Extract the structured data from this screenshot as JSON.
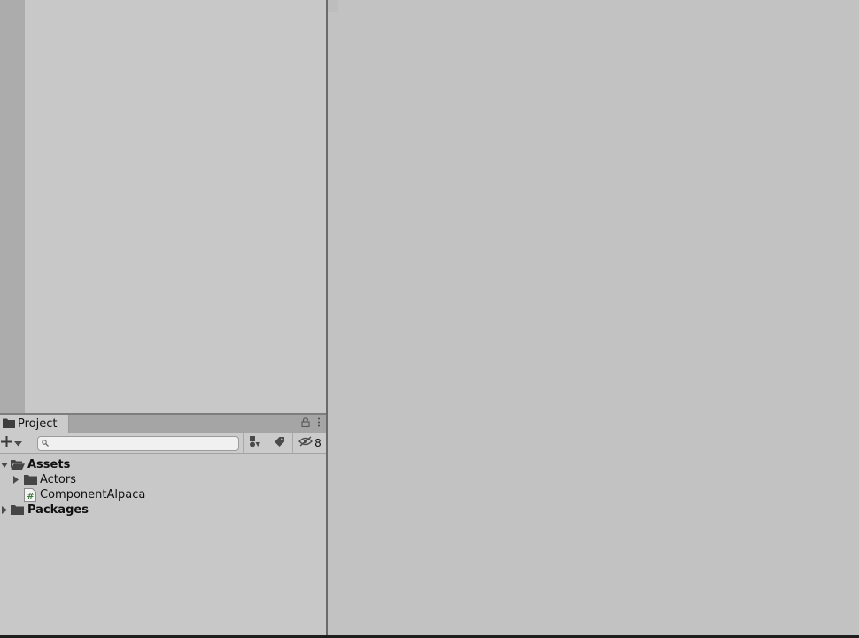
{
  "project_panel": {
    "tab": {
      "label": "Project",
      "icon": "folder-icon"
    },
    "tab_tools": {
      "lock_icon": "lock-icon",
      "menu_icon": "kebab-menu-icon"
    },
    "toolbar": {
      "create_icon": "plus-icon",
      "dropdown_icon": "chevron-down-icon",
      "search": {
        "placeholder": "",
        "value": "",
        "icon": "search-icon"
      },
      "filter_type_icon": "filter-by-type-icon",
      "filter_label_icon": "filter-by-label-icon",
      "hidden_packages_icon": "eye-slash-icon",
      "hidden_packages_count": "8"
    },
    "tree": [
      {
        "label": "Assets",
        "bold": true,
        "expanded": true,
        "icon": "folder-open-icon"
      },
      {
        "label": "Actors",
        "bold": false,
        "expanded": false,
        "icon": "folder-icon"
      },
      {
        "label": "ComponentAlpaca",
        "bold": false,
        "icon": "csharp-script-icon"
      },
      {
        "label": "Packages",
        "bold": true,
        "expanded": false,
        "icon": "folder-icon"
      }
    ]
  },
  "colors": {
    "panel_bg": "#c8c8c8",
    "tab_bar_bg": "#a5a5a5",
    "scene_bg": "#c2c2c2",
    "sidebar_strip": "#acacac",
    "splitter": "#6a6a6a"
  }
}
